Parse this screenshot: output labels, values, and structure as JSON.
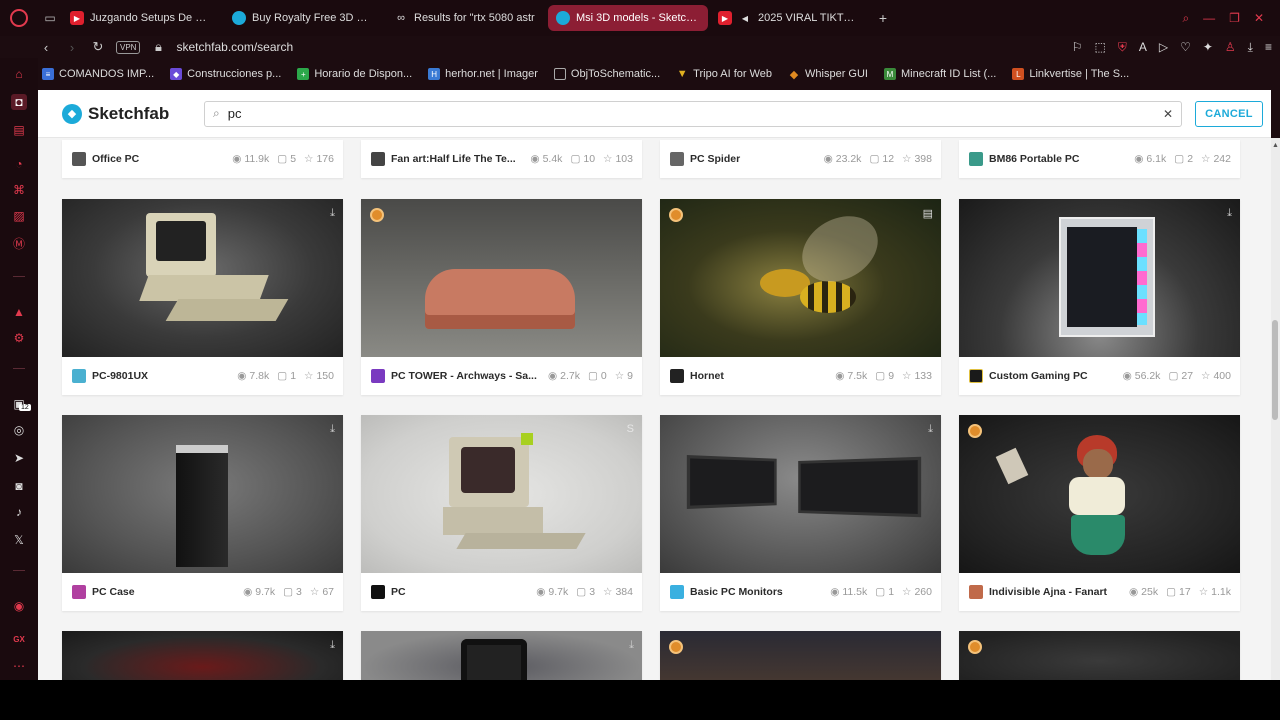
{
  "tabs": [
    {
      "title": "Juzgando Setups De OTR",
      "fav": "#e0202e"
    },
    {
      "title": "Buy Royalty Free 3D mod",
      "fav": "#1caad9"
    },
    {
      "title": "Results for \"rtx 5080 astr",
      "fav": "#555"
    },
    {
      "title": "Msi 3D models - Sketchfa",
      "fav": "#1caad9"
    },
    {
      "title": "2025 VIRAL TIKTOK P",
      "fav": "#e0202e"
    }
  ],
  "address": {
    "vpn": "VPN",
    "url": "sketchfab.com/search"
  },
  "bookmarks": [
    {
      "label": "COMANDOS IMP...",
      "color": "#3a6fd8"
    },
    {
      "label": "Construcciones p...",
      "color": "#6a4bd8"
    },
    {
      "label": "Horario de Dispon...",
      "color": "#2ca84a"
    },
    {
      "label": "herhor.net | Imager",
      "color": "#3a7bd5"
    },
    {
      "label": "ObjToSchematic...",
      "color": "#777"
    },
    {
      "label": "Tripo AI for Web",
      "color": "#e0b020"
    },
    {
      "label": "Whisper GUI",
      "color": "#e08a20"
    },
    {
      "label": "Minecraft ID List (...",
      "color": "#3a8a3a"
    },
    {
      "label": "Linkvertise | The S...",
      "color": "#d05020"
    }
  ],
  "sidebar": {
    "badge": "12",
    "gx": "GX"
  },
  "sketchfab": {
    "logo": "Sketchfab",
    "query": "pc",
    "cancel": "CANCEL"
  },
  "top_row": [
    {
      "title": "Office PC",
      "views": "11.9k",
      "comments": "5",
      "likes": "176"
    },
    {
      "title": "Fan art:Half Life The Te...",
      "views": "5.4k",
      "comments": "10",
      "likes": "103"
    },
    {
      "title": "PC Spider",
      "views": "23.2k",
      "comments": "12",
      "likes": "398"
    },
    {
      "title": "BM86 Portable PC",
      "views": "6.1k",
      "comments": "2",
      "likes": "242"
    }
  ],
  "row1": [
    {
      "title": "PC-9801UX",
      "views": "7.8k",
      "comments": "1",
      "likes": "150"
    },
    {
      "title": "PC TOWER - Archways - Sa...",
      "views": "2.7k",
      "comments": "0",
      "likes": "9"
    },
    {
      "title": "Hornet",
      "views": "7.5k",
      "comments": "9",
      "likes": "133"
    },
    {
      "title": "Custom Gaming PC",
      "views": "56.2k",
      "comments": "27",
      "likes": "400"
    }
  ],
  "row2": [
    {
      "title": "PC Case",
      "views": "9.7k",
      "comments": "3",
      "likes": "67"
    },
    {
      "title": "PC",
      "views": "9.7k",
      "comments": "3",
      "likes": "384"
    },
    {
      "title": "Basic PC Monitors",
      "views": "11.5k",
      "comments": "1",
      "likes": "260"
    },
    {
      "title": "Indivisible Ajna - Fanart",
      "views": "25k",
      "comments": "17",
      "likes": "1.1k"
    }
  ],
  "colors": {
    "accent": "#1caad9",
    "opera_red": "#e23a4e",
    "active_tab": "#8c1e34"
  }
}
